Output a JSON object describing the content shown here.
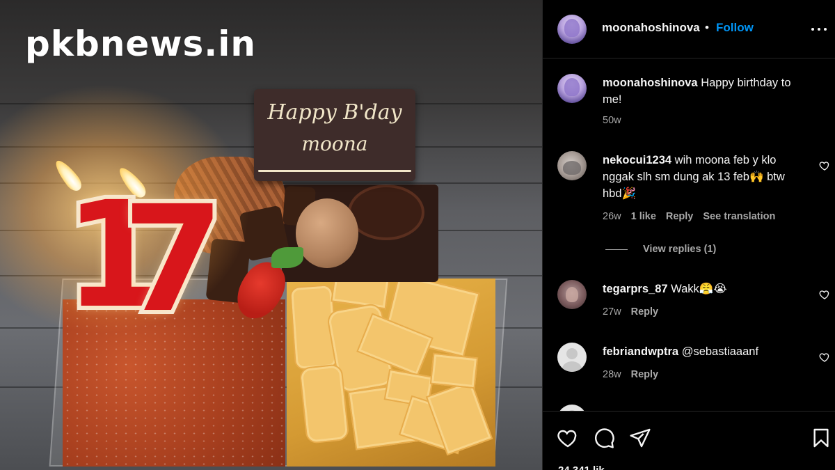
{
  "watermark": "pkbnews.in",
  "photo": {
    "plaque_line1": "Happy B'day",
    "plaque_line2": "moona",
    "candle_digit_1": "1",
    "candle_digit_2": "7"
  },
  "post": {
    "author": "moonahoshinova",
    "separator": "•",
    "follow_label": "Follow",
    "caption": {
      "username": "moonahoshinova",
      "text": "Happy birthday to me!",
      "age": "50w"
    },
    "comments": [
      {
        "username": "nekocui1234",
        "text": "wih moona feb y klo nggak slh sm dung ak 13 feb🙌 btw hbd🎉",
        "age": "26w",
        "likes": "1 like",
        "reply_label": "Reply",
        "translation_label": "See translation",
        "view_replies": "View replies (1)"
      },
      {
        "username": "tegarprs_87",
        "text": "Wakk😤😭",
        "age": "27w",
        "reply_label": "Reply"
      },
      {
        "username": "febriandwptra",
        "text": "@sebastiaaanf",
        "age": "28w",
        "reply_label": "Reply"
      }
    ],
    "likes_partial": "24,341 lik"
  },
  "colors": {
    "accent": "#0095f6",
    "background": "#000000",
    "text": "#f5f5f5",
    "muted": "#a8a8a8",
    "divider": "#262626"
  },
  "icons": [
    "more-icon",
    "heart-icon",
    "comment-icon",
    "share-icon",
    "bookmark-icon"
  ]
}
